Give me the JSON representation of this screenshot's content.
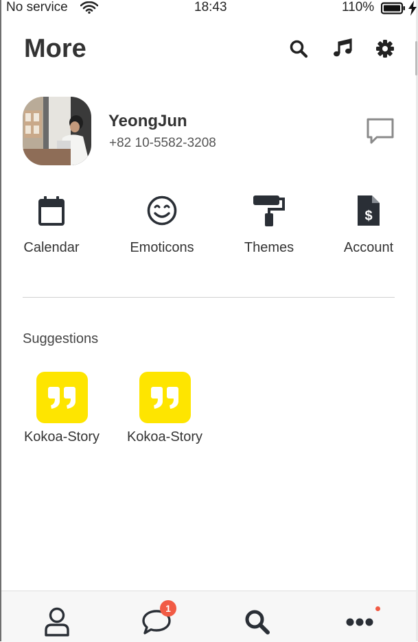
{
  "status_bar": {
    "carrier": "No service",
    "time": "18:43",
    "battery_percent": "110%"
  },
  "header": {
    "title": "More",
    "icons": [
      "search-icon",
      "music-note-icon",
      "gear-icon"
    ]
  },
  "profile": {
    "name": "YeongJun",
    "phone": "+82 10-5582-3208",
    "action_icon": "chat-bubble-icon"
  },
  "menu": [
    {
      "label": "Calendar",
      "icon": "calendar-icon"
    },
    {
      "label": "Emoticons",
      "icon": "smile-icon"
    },
    {
      "label": "Themes",
      "icon": "paint-roller-icon"
    },
    {
      "label": "Account",
      "icon": "invoice-dollar-icon"
    }
  ],
  "suggestions": {
    "heading": "Suggestions",
    "items": [
      {
        "label": "Kokoa-Story",
        "icon": "quote-icon"
      },
      {
        "label": "Kokoa-Story",
        "icon": "quote-icon"
      }
    ]
  },
  "bottom_nav": {
    "tabs": [
      {
        "name": "friends",
        "icon": "person-icon"
      },
      {
        "name": "chats",
        "icon": "chat-bubble-icon",
        "badge": "1"
      },
      {
        "name": "find",
        "icon": "search-icon"
      },
      {
        "name": "more",
        "icon": "more-dots-icon"
      }
    ]
  },
  "colors": {
    "accent_yellow": "#fee500",
    "badge_red": "#f15b45",
    "icon_dark": "#2a2f36"
  }
}
